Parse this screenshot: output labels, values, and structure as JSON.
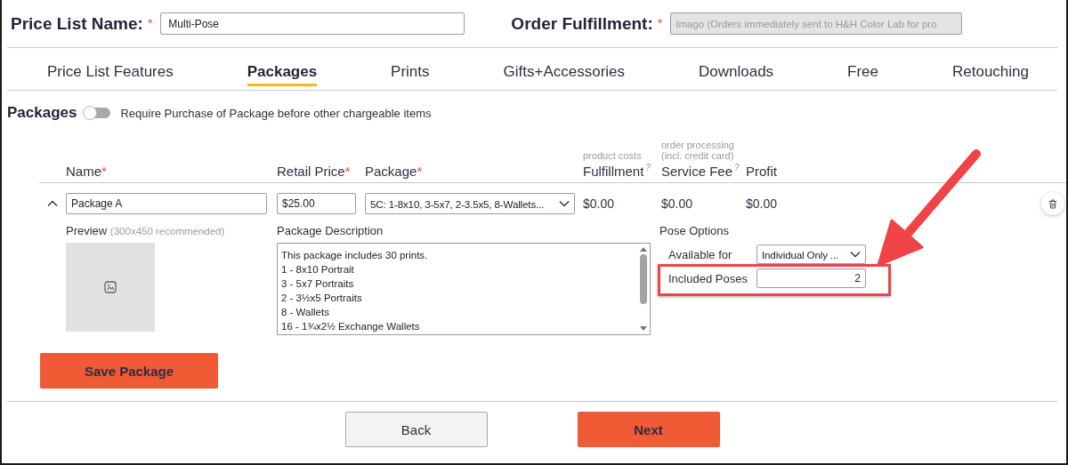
{
  "header": {
    "price_list_name": {
      "label": "Price List Name:",
      "required_mark": "*",
      "value": "Multi-Pose",
      "disabled": false
    },
    "order_fulfillment": {
      "label": "Order Fulfillment:",
      "required_mark": "*",
      "value": "Imago (Orders immediately sent to H&H Color Lab for pro",
      "disabled": true
    }
  },
  "tabs": [
    {
      "label": "Price List Features",
      "selected": false
    },
    {
      "label": "Packages",
      "selected": true
    },
    {
      "label": "Prints",
      "selected": false
    },
    {
      "label": "Gifts+Accessories",
      "selected": false
    },
    {
      "label": "Downloads",
      "selected": false
    },
    {
      "label": "Free",
      "selected": false
    },
    {
      "label": "Retouching",
      "selected": false
    }
  ],
  "packages_section": {
    "title": "Packages",
    "toggle": {
      "on": false,
      "label": "Require Purchase of Package before other chargeable items"
    }
  },
  "columns": [
    {
      "label": "Name",
      "required_mark": "*"
    },
    {
      "label": "Retail Price",
      "required_mark": "*"
    },
    {
      "label": "Package",
      "required_mark": "*"
    },
    {
      "hint": "product costs",
      "label": "Fulfillment",
      "help": "?"
    },
    {
      "hint": "order processing (incl. credit card)",
      "label": "Service Fee",
      "help": "?"
    },
    {
      "label": "Profit"
    }
  ],
  "package_rows": [
    {
      "expanded": true,
      "name": "Package A",
      "retail_price": "$25.00",
      "package": "5C: 1-8x10, 3-5x7, 2-3.5x5, 8-Wallets...",
      "fulfillment": "$0.00",
      "service_fee": "$0.00",
      "profit": "$0.00",
      "preview": {
        "label": "Preview",
        "hint": "(300x450 recommended)"
      },
      "description": {
        "label": "Package Description",
        "lines": [
          "This package includes 30 prints.",
          "1 - 8x10 Portrait",
          "3 - 5x7 Portraits",
          "2 - 3½x5 Portraits",
          "8 - Wallets",
          "16 - 1¾x2½ Exchange Wallets"
        ]
      },
      "pose_options": {
        "title": "Pose Options",
        "available_for": {
          "label": "Available for",
          "value": "Individual Only ..."
        },
        "included_poses": {
          "label": "Included Poses",
          "value": "2",
          "highlighted": true
        }
      },
      "save_button": "Save Package"
    }
  ],
  "footer": {
    "back_button": "Back",
    "next_button": "Next"
  }
}
